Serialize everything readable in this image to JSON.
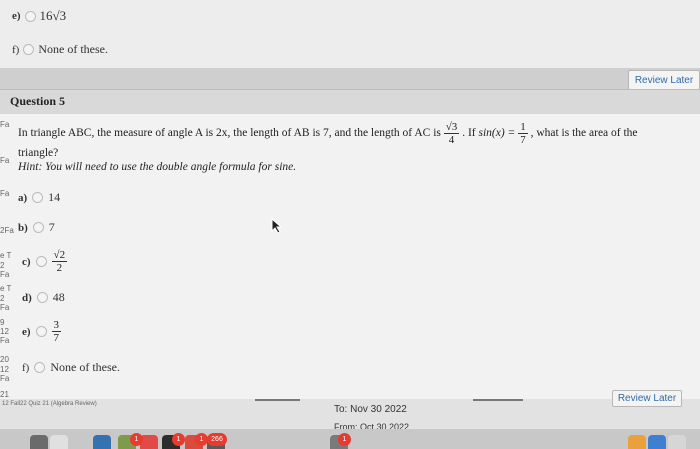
{
  "prev_question": {
    "option_e": {
      "label": "e)",
      "text": "16√3"
    },
    "option_f": {
      "label": "f)",
      "text": "None of these."
    }
  },
  "review_later_top": "Review Later",
  "question": {
    "title": "Question 5",
    "text_part1": "In triangle ABC, the measure of angle A is 2x, the length of AB is 7, and the length of AC is",
    "ac_num": "√3",
    "ac_den": "4",
    "text_part2": ". If",
    "sin_expr": "sin(x) =",
    "sin_num": "1",
    "sin_den": "7",
    "text_part3": ", what is the area of the",
    "text_line2": "triangle?",
    "hint": "Hint: You will need to use the double angle formula for sine.",
    "options": [
      {
        "label": "a)",
        "text": "14"
      },
      {
        "label": "b)",
        "text": "7"
      },
      {
        "label": "c)",
        "num": "√2",
        "den": "2"
      },
      {
        "label": "d)",
        "text": "48"
      },
      {
        "label": "e)",
        "num": "3",
        "den": "7"
      },
      {
        "label": "f)",
        "text": "None of these."
      }
    ]
  },
  "background": {
    "gutter": [
      "Fa",
      "Fa",
      "Fa",
      "2Fa",
      "e T",
      "2 Fa",
      "e T",
      "2 Fa",
      "9",
      "12 Fa",
      "20",
      "12 Fa",
      "21"
    ],
    "footer_label": "12 Fall22 Quiz 21 (Algebra Review)",
    "to_date": "To: Nov 30 2022",
    "from_date": "From: Oct 30 2022",
    "review_later_bottom": "Review Later"
  },
  "dock": {
    "badges": [
      "1",
      "1",
      "1",
      "266",
      "1"
    ]
  }
}
